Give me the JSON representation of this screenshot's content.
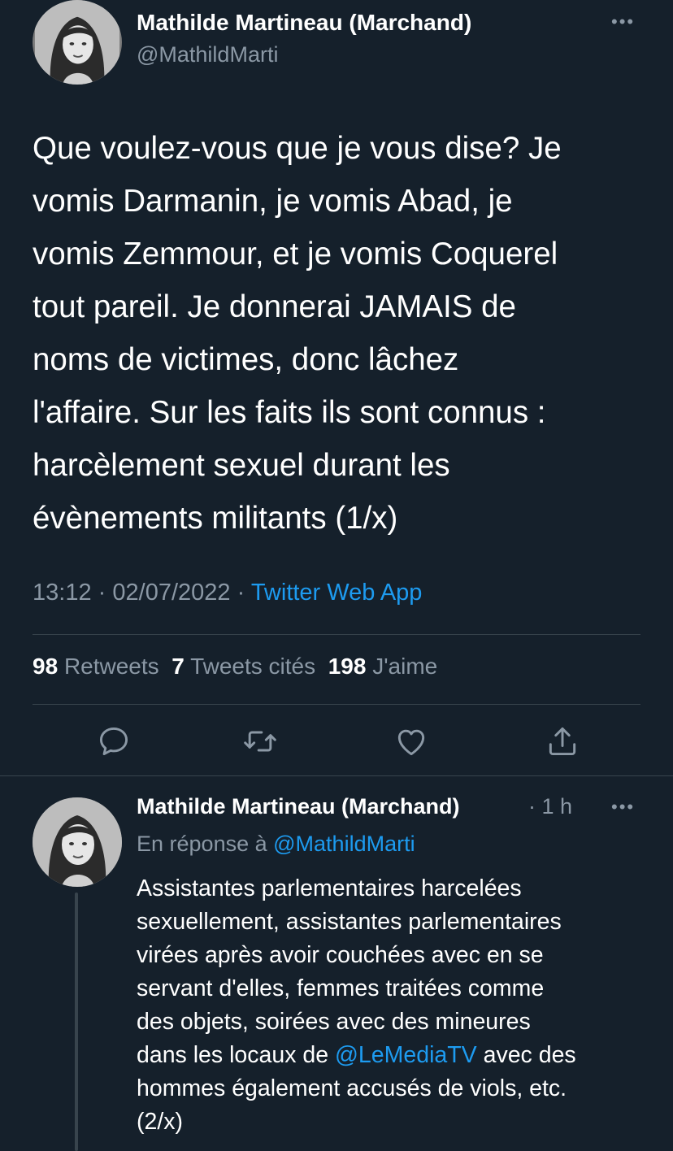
{
  "tweet": {
    "author_name": "Mathilde Martineau (Marchand)",
    "author_handle": "@MathildMarti",
    "more_icon": "•••",
    "text_lines": [
      "Que voulez-vous que je vous dise? Je",
      "vomis Darmanin, je vomis Abad, je",
      "vomis Zemmour, et je vomis Coquerel",
      "tout pareil. Je donnerai JAMAIS de",
      "noms de victimes, donc lâchez",
      "l'affaire. Sur les faits ils sont connus :",
      "harcèlement sexuel durant les",
      "évènements militants (1/x)"
    ],
    "time": "13:12",
    "date": "02/07/2022",
    "separator": "·",
    "source": "Twitter Web App",
    "retweets_count": "98",
    "retweets_label": "Retweets",
    "quotes_count": "7",
    "quotes_label": "Tweets cités",
    "likes_count": "198",
    "likes_label": "J'aime",
    "actions": [
      "reply-icon",
      "retweet-icon",
      "like-icon",
      "share-icon"
    ]
  },
  "reply": {
    "author_name": "Mathilde Martineau (Marchand)",
    "time": "· 1 h",
    "more_icon": "•••",
    "in_reply_prefix": "En réponse à",
    "in_reply_handle": "@MathildMarti",
    "text_lines": [
      "Assistantes parlementaires harcelées",
      "sexuellement, assistantes parlementaires",
      "virées après avoir couchées avec en se",
      "servant d'elles, femmes traitées comme",
      "des objets, soirées avec des mineures"
    ],
    "line6_before": "dans les locaux de ",
    "line6_mention": "@LeMediaTV",
    "line6_after": " avec des",
    "text_lines_end": [
      "hommes également accusés de viols, etc.",
      "(2/x)"
    ]
  },
  "colors": {
    "background": "#15202b",
    "text": "#ffffff",
    "muted": "#8b98a5",
    "accent": "#1d9bf0",
    "divider": "#38444d"
  }
}
